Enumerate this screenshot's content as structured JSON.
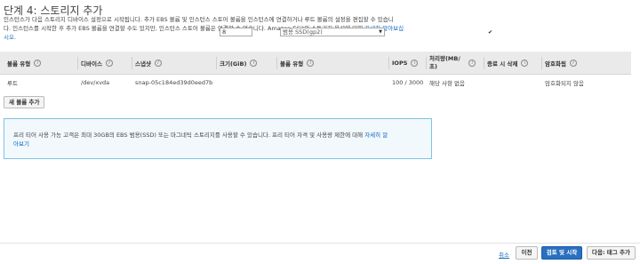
{
  "header": {
    "title": "단계 4: 스토리지 추가",
    "desc_line1": "인스턴스가 다음 스토리지 디바이스 설정으로 시작됩니다. 추가 EBS 볼륨 및 인스턴스 스토어 볼륨을 인스턴스에 연결하거나 루트 볼륨의 설정을 편집할 수 있습니",
    "desc_line2_a": "다. 인스턴스를 시작한 후 추가 EBS 볼륨을 연결할 수도 있지만, 인스턴스 스토어 볼륨은 연결할 수 없습니다. Amazon EC2의 스토리지 옵션에 대해 ",
    "desc_link_a": "자세히 알아보십",
    "desc_link_b": "시오."
  },
  "table": {
    "headers": {
      "volume_type": "볼륨 유형",
      "device": "디바이스",
      "snapshot": "스냅샷",
      "size": "크기(GiB)",
      "vol_type": "볼륨 유형",
      "iops": "IOPS",
      "throughput": "처리량(MB/초)",
      "delete_on_termination": "종료 시 삭제",
      "encryption": "암호화됨"
    },
    "row": {
      "volume_type": "루트",
      "device": "/dev/xvda",
      "snapshot": "snap-05c184ed39d0eed7b",
      "size": "8",
      "vol_type": "범용 SSD(gp2)",
      "iops": "100 / 3000",
      "throughput": "해당 사항 없음",
      "delete_checked": "✔",
      "encryption": "암호화되지 않음"
    }
  },
  "add_volume_button": "새 볼륨 추가",
  "infobox": {
    "text_a": "프리 티어 사용 가능 고객은 최대 30GB의 EBS 범용(SSD) 또는 마그네틱 스토리지를 사용할 수 있습니다. 프리 티어 자격 및 사용량 제한에 대해 ",
    "link_a": "자세히 알",
    "link_b": "아보기"
  },
  "footer": {
    "cancel": "취소",
    "previous": "이전",
    "review_launch": "검토 및 시작",
    "next": "다음: 태그 추가"
  },
  "icons": {
    "info": "i",
    "dropdown": "▼"
  },
  "colors": {
    "link": "#1166bb",
    "primary_button": "#2a6fc0",
    "info_border": "#7fc3e3"
  }
}
